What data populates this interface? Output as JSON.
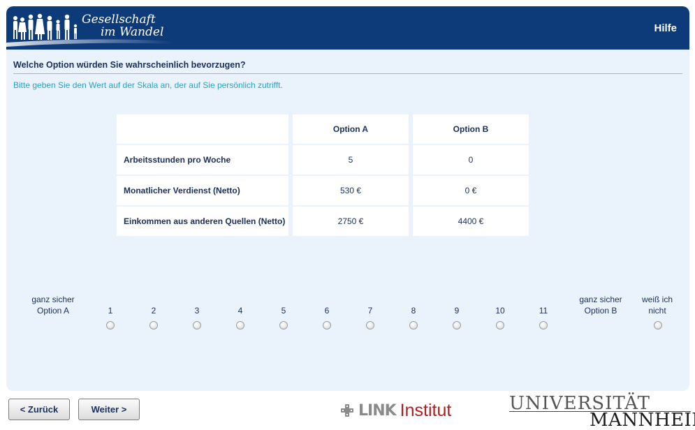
{
  "header": {
    "logo_line1": "Gesellschaft",
    "logo_line2": "im Wandel",
    "help_label": "Hilfe"
  },
  "question": {
    "title": "Welche Option würden Sie wahrscheinlich bevorzugen?",
    "instruction": "Bitte geben Sie den Wert auf der Skala an, der auf Sie persönlich zutrifft."
  },
  "table": {
    "columns": [
      "",
      "Option A",
      "Option B"
    ],
    "rows": [
      {
        "label": "Arbeitsstunden pro Woche",
        "a": "5",
        "b": "0"
      },
      {
        "label": "Monatlicher Verdienst (Netto)",
        "a": "530 €",
        "b": "0 €"
      },
      {
        "label": "Einkommen aus anderen Quellen (Netto)",
        "a": "2750 €",
        "b": "4400 €"
      }
    ]
  },
  "scale": {
    "left_label": "ganz sicher Option A",
    "right_label": "ganz sicher Option B",
    "dont_know_label": "weiß ich nicht",
    "points": [
      "1",
      "2",
      "3",
      "4",
      "5",
      "6",
      "7",
      "8",
      "9",
      "10",
      "11"
    ],
    "selected": null
  },
  "nav": {
    "back_label": "< Zurück",
    "next_label": "Weiter >"
  },
  "footer": {
    "link_word": "LINK",
    "link_institut": "Institut",
    "uni_line1": "UNIVERSITÄT",
    "uni_line2": "MANNHEIM"
  },
  "colors": {
    "header_bg": "#0d3a78",
    "page_bg": "#eaf2fb",
    "text": "#1b2f5c",
    "instruction": "#2aa2c7",
    "link_red": "#b01d1d"
  }
}
